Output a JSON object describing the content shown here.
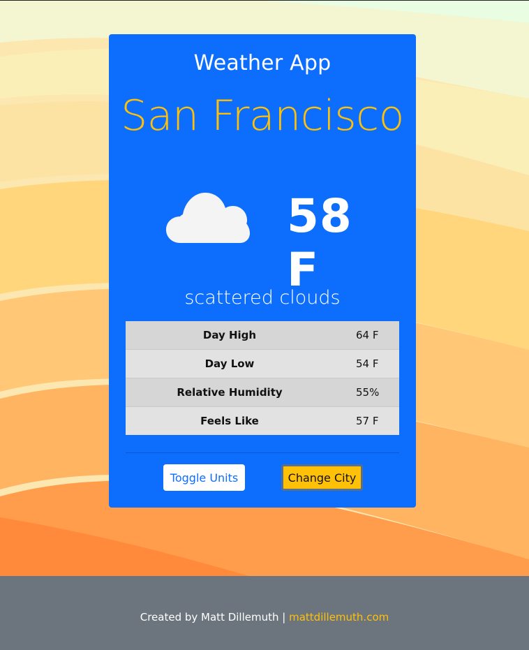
{
  "app": {
    "title": "Weather App",
    "city": "San Francisco",
    "temperature": "58 F",
    "description": "scattered clouds",
    "icon": "cloud-icon"
  },
  "details": [
    {
      "label": "Day High",
      "value": "64 F"
    },
    {
      "label": "Day Low",
      "value": "54 F"
    },
    {
      "label": "Relative Humidity",
      "value": "55%"
    },
    {
      "label": "Feels Like",
      "value": "57 F"
    }
  ],
  "buttons": {
    "toggle_units": "Toggle Units",
    "change_city": "Change City"
  },
  "footer": {
    "text": "Created by Matt Dillemuth |",
    "link": "mattdillemuth.com"
  },
  "colors": {
    "card": "#0d6efd",
    "accent": "#ffc107",
    "footer": "#6c757d"
  }
}
